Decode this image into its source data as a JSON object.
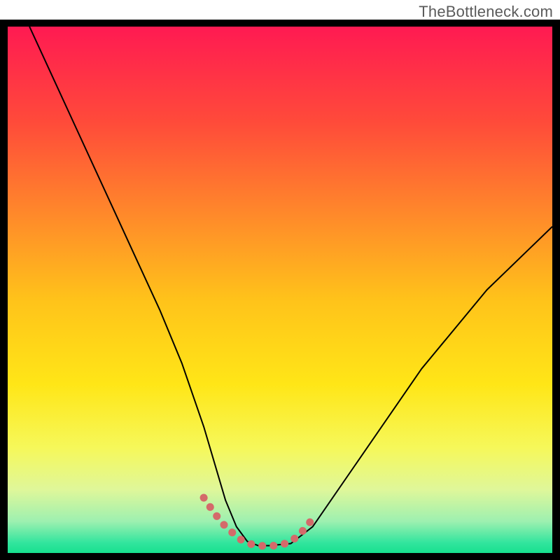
{
  "watermark": "TheBottleneck.com",
  "chart_data": {
    "type": "line",
    "title": "",
    "xlabel": "",
    "ylabel": "",
    "xlim": [
      0,
      100
    ],
    "ylim": [
      0,
      100
    ],
    "grid": false,
    "legend": false,
    "background": {
      "type": "vertical-gradient",
      "stops": [
        {
          "pos": 0.0,
          "color": "#ff1a52"
        },
        {
          "pos": 0.18,
          "color": "#ff4a3a"
        },
        {
          "pos": 0.36,
          "color": "#ff8a2a"
        },
        {
          "pos": 0.52,
          "color": "#ffc31a"
        },
        {
          "pos": 0.68,
          "color": "#ffe617"
        },
        {
          "pos": 0.8,
          "color": "#f6f85a"
        },
        {
          "pos": 0.88,
          "color": "#dff79a"
        },
        {
          "pos": 0.94,
          "color": "#9df0b0"
        },
        {
          "pos": 0.98,
          "color": "#33e59e"
        },
        {
          "pos": 1.0,
          "color": "#17e08e"
        }
      ]
    },
    "series": [
      {
        "name": "bottleneck-curve",
        "stroke": "#000000",
        "stroke_width": 2,
        "x": [
          4,
          8,
          12,
          16,
          20,
          24,
          28,
          32,
          34,
          36,
          38,
          40,
          42,
          44,
          46,
          48,
          52,
          56,
          60,
          64,
          68,
          72,
          76,
          80,
          84,
          88,
          92,
          96,
          100
        ],
        "y_pct": [
          100,
          91,
          82,
          73,
          64,
          55,
          46,
          36,
          30,
          24,
          17,
          10,
          5,
          2.2,
          1.4,
          1.4,
          1.8,
          5,
          11,
          17,
          23,
          29,
          35,
          40,
          45,
          50,
          54,
          58,
          62
        ]
      },
      {
        "name": "optimal-band",
        "stroke": "#d46a6a",
        "stroke_width": 11,
        "linecap": "round",
        "dash": "0.1 16",
        "x": [
          36,
          38,
          40,
          42,
          43,
          44,
          45,
          46,
          47,
          48,
          49,
          50,
          51,
          52,
          53,
          54,
          55,
          56
        ],
        "y_pct": [
          10.5,
          7.5,
          5,
          3.2,
          2.4,
          1.9,
          1.6,
          1.4,
          1.35,
          1.35,
          1.4,
          1.55,
          1.8,
          2.2,
          3.0,
          4.0,
          5.2,
          6.5
        ]
      }
    ]
  }
}
